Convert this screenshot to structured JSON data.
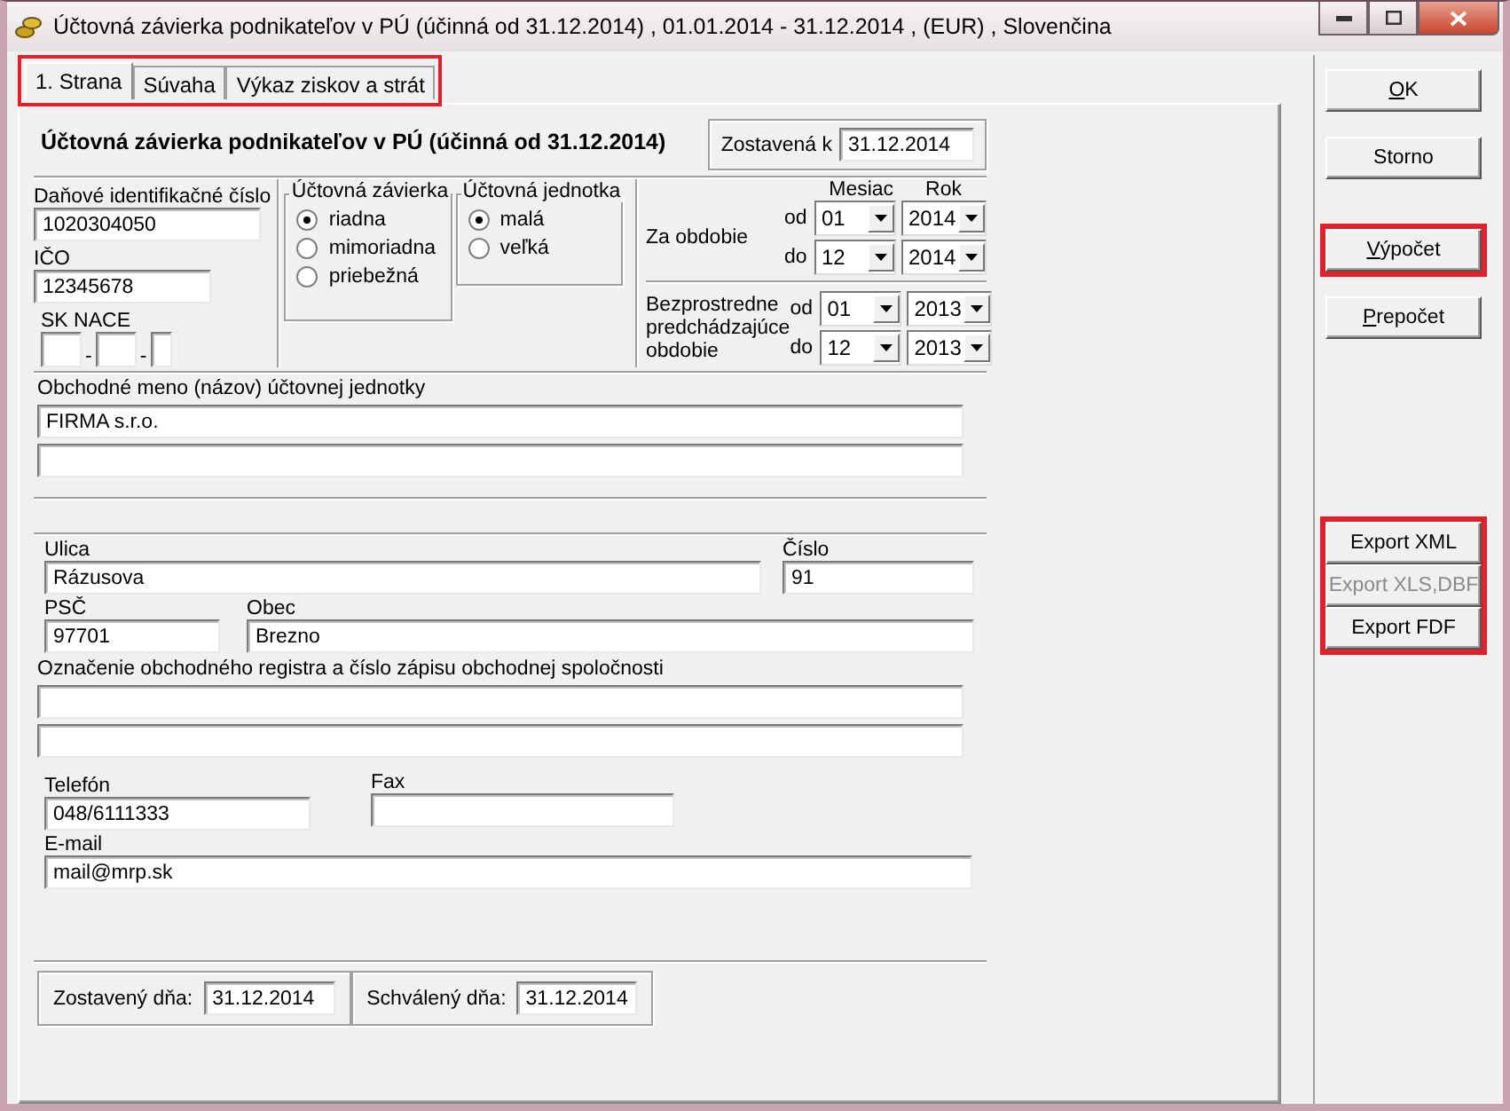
{
  "window": {
    "title": "Účtovná závierka podnikateľov v PÚ (účinná od 31.12.2014) ,  01.01.2014 - 31.12.2014 ,  (EUR) ,  Slovenčina"
  },
  "tabs_highlighted": true,
  "tabs": [
    {
      "label": "1. Strana",
      "selected": true
    },
    {
      "label": "Súvaha",
      "selected": false
    },
    {
      "label": "Výkaz ziskov a strát",
      "selected": false
    }
  ],
  "heading": "Účtovná závierka podnikateľov v PÚ (účinná od 31.12.2014)",
  "zostavena_k": {
    "label": "Zostavená k",
    "value": "31.12.2014"
  },
  "dic": {
    "label": "Daňové identifikačné číslo",
    "value": "1020304050"
  },
  "ico": {
    "label": "IČO",
    "value": "12345678"
  },
  "sk_nace": {
    "label": "SK NACE",
    "separators": [
      "-",
      "-"
    ]
  },
  "uctovna_zavierka": {
    "label": "Účtovná závierka",
    "options": [
      {
        "label": "riadna",
        "selected": true
      },
      {
        "label": "mimoriadna",
        "selected": false
      },
      {
        "label": "priebežná",
        "selected": false
      }
    ]
  },
  "uctovna_jednotka": {
    "label": "Účtovná jednotka",
    "options": [
      {
        "label": "malá",
        "selected": true
      },
      {
        "label": "veľká",
        "selected": false
      }
    ]
  },
  "period_headers": {
    "month": "Mesiac",
    "year": "Rok"
  },
  "periods": [
    {
      "label": "Za obdobie",
      "rows": [
        {
          "label": "od",
          "month": "01",
          "year": "2014"
        },
        {
          "label": "do",
          "month": "12",
          "year": "2014"
        }
      ]
    },
    {
      "label": "Bezprostredne predchádzajúce obdobie",
      "rows": [
        {
          "label": "od",
          "month": "01",
          "year": "2013"
        },
        {
          "label": "do",
          "month": "12",
          "year": "2013"
        }
      ]
    }
  ],
  "obchodne_meno": {
    "label": "Obchodné meno (názov) účtovnej jednotky",
    "lines": [
      "FIRMA s.r.o."
    ]
  },
  "ulica": {
    "label": "Ulica",
    "value": "Rázusova"
  },
  "cislo": {
    "label": "Číslo",
    "value": "91"
  },
  "psc": {
    "label": "PSČ",
    "value": "97701"
  },
  "obec": {
    "label": "Obec",
    "value": "Brezno"
  },
  "register": {
    "label": "Označenie obchodného registra a číslo zápisu obchodnej spoločnosti"
  },
  "telefon": {
    "label": "Telefón",
    "value": "048/6111333"
  },
  "fax": {
    "label": "Fax"
  },
  "email": {
    "label": "E-mail",
    "value": "mail@mrp.sk"
  },
  "zostaveny_dna": {
    "label": "Zostavený dňa:",
    "value": "31.12.2014"
  },
  "schvaleny_dna": {
    "label": "Schválený dňa:",
    "value": "31.12.2014"
  },
  "buttons": [
    {
      "label": "OK",
      "mnemonic": true,
      "highlighted": false
    },
    {
      "label": "Storno",
      "mnemonic": false,
      "highlighted": false
    },
    {
      "label": "Výpočet",
      "mnemonic": true,
      "highlighted": true
    },
    {
      "label": "Prepočet",
      "mnemonic": true,
      "highlighted": false
    }
  ],
  "export_highlighted": true,
  "export_buttons": [
    {
      "label": "Export XML",
      "disabled": false
    },
    {
      "label": "Export XLS,DBF",
      "disabled": true
    },
    {
      "label": "Export FDF",
      "disabled": false
    }
  ]
}
